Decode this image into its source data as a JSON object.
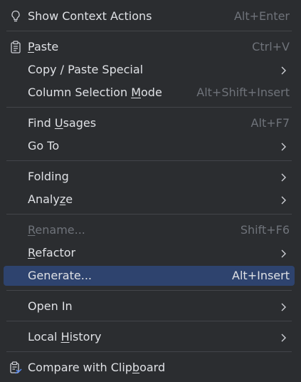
{
  "menu": {
    "items": [
      {
        "label_parts": [
          "Show Context Actions"
        ],
        "shortcut": "Alt+Enter",
        "icon": "lightbulb-icon"
      },
      {
        "label_parts": [
          "",
          "P",
          "aste"
        ],
        "shortcut": "Ctrl+V",
        "icon": "clipboard-icon"
      },
      {
        "label_parts": [
          "Copy / Paste Special"
        ],
        "submenu": true
      },
      {
        "label_parts": [
          "Column Selection ",
          "M",
          "ode"
        ],
        "shortcut": "Alt+Shift+Insert"
      },
      {
        "label_parts": [
          "Find ",
          "U",
          "sages"
        ],
        "shortcut": "Alt+F7"
      },
      {
        "label_parts": [
          "Go To"
        ],
        "submenu": true
      },
      {
        "label_parts": [
          "Folding"
        ],
        "submenu": true
      },
      {
        "label_parts": [
          "Analy",
          "z",
          "e"
        ],
        "submenu": true
      },
      {
        "label_parts": [
          "",
          "R",
          "ename..."
        ],
        "shortcut": "Shift+F6",
        "disabled": true
      },
      {
        "label_parts": [
          "",
          "R",
          "efactor"
        ],
        "submenu": true
      },
      {
        "label_parts": [
          "Generate..."
        ],
        "shortcut": "Alt+Insert",
        "selected": true
      },
      {
        "label_parts": [
          "Open In"
        ],
        "submenu": true
      },
      {
        "label_parts": [
          "Local ",
          "H",
          "istory"
        ],
        "submenu": true
      },
      {
        "label_parts": [
          "Compare with Clip",
          "b",
          "oard"
        ],
        "icon": "compare-clipboard-icon"
      }
    ]
  },
  "colors": {
    "background": "#2b2d30",
    "selection": "#2e436e",
    "text": "#dfe1e5",
    "muted": "#6f737a",
    "separator": "#43454a"
  }
}
